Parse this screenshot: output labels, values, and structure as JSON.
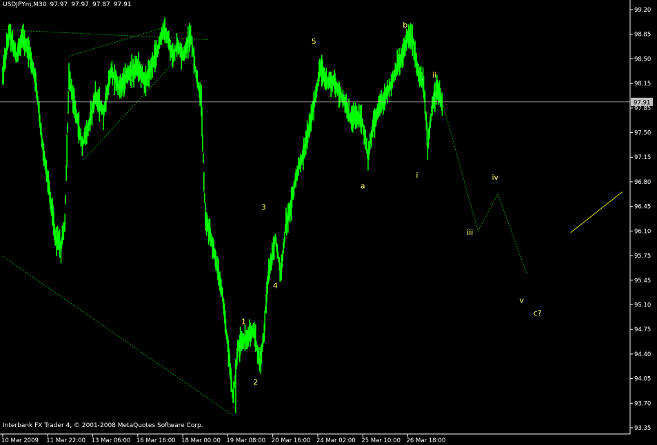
{
  "header": {
    "symbol": "USDJPYm,M30",
    "ohlc": [
      "97.97",
      "97.97",
      "97.87",
      "97.91"
    ]
  },
  "footer": {
    "copyright": "Interbank FX Trader 4, © 2001-2008 MetaQuotes Software Corp."
  },
  "colors": {
    "background": "#000000",
    "candles": "#00ff00",
    "trendlines": "#00a000",
    "wave_labels": "#ffff66",
    "price_line": "#c0c0c0",
    "axis": "#ffffff"
  },
  "chart_data": {
    "type": "line",
    "symbol": "USDJPYm",
    "timeframe": "M30",
    "ylim": [
      93.35,
      99.2
    ],
    "grid": false,
    "current_price": "97.91",
    "y_ticks": [
      "99.20",
      "98.85",
      "98.50",
      "98.15",
      "97.85",
      "97.50",
      "97.15",
      "96.80",
      "96.45",
      "96.10",
      "95.75",
      "95.45",
      "95.10",
      "94.75",
      "94.40",
      "94.05",
      "93.70",
      "93.35"
    ],
    "x_ticks": [
      "10 Mar 2009",
      "11 Mar 22:00",
      "13 Mar 06:00",
      "16 Mar 16:00",
      "18 Mar 00:00",
      "19 Mar 08:00",
      "20 Mar 16:00",
      "24 Mar 02:00",
      "25 Mar 10:00",
      "26 Mar 18:00"
    ],
    "x_tick_bar_index": [
      0,
      34,
      68,
      102,
      136,
      170,
      204,
      238,
      272,
      306
    ],
    "series": [
      {
        "name": "",
        "price_path": [
          [
            0,
            98.3
          ],
          [
            5,
            98.9
          ],
          [
            10,
            98.55
          ],
          [
            15,
            98.8
          ],
          [
            20,
            98.6
          ],
          [
            25,
            98.2
          ],
          [
            30,
            97.3
          ],
          [
            35,
            96.7
          ],
          [
            40,
            96.0
          ],
          [
            44,
            95.9
          ],
          [
            47,
            96.2
          ],
          [
            50,
            98.25
          ],
          [
            55,
            97.8
          ],
          [
            60,
            97.3
          ],
          [
            64,
            97.5
          ],
          [
            70,
            98.0
          ],
          [
            76,
            97.75
          ],
          [
            82,
            98.35
          ],
          [
            88,
            98.1
          ],
          [
            95,
            98.3
          ],
          [
            102,
            98.4
          ],
          [
            108,
            98.2
          ],
          [
            114,
            98.5
          ],
          [
            118,
            98.7
          ],
          [
            122,
            98.95
          ],
          [
            128,
            98.55
          ],
          [
            132,
            98.7
          ],
          [
            136,
            98.55
          ],
          [
            142,
            98.85
          ],
          [
            146,
            98.3
          ],
          [
            150,
            97.9
          ],
          [
            153,
            96.3
          ],
          [
            160,
            95.8
          ],
          [
            166,
            95.2
          ],
          [
            170,
            94.5
          ],
          [
            174,
            93.75
          ],
          [
            178,
            94.5
          ],
          [
            184,
            94.6
          ],
          [
            190,
            94.7
          ],
          [
            194,
            94.25
          ],
          [
            197,
            94.6
          ],
          [
            200,
            95.4
          ],
          [
            206,
            96.0
          ],
          [
            210,
            95.5
          ],
          [
            214,
            96.2
          ],
          [
            218,
            96.5
          ],
          [
            222,
            96.9
          ],
          [
            226,
            97.1
          ],
          [
            232,
            97.6
          ],
          [
            236,
            97.95
          ],
          [
            240,
            98.4
          ],
          [
            244,
            98.2
          ],
          [
            250,
            98.2
          ],
          [
            256,
            98.0
          ],
          [
            262,
            97.7
          ],
          [
            268,
            97.7
          ],
          [
            272,
            97.6
          ],
          [
            276,
            97.15
          ],
          [
            280,
            97.6
          ],
          [
            286,
            97.9
          ],
          [
            292,
            98.1
          ],
          [
            298,
            98.4
          ],
          [
            302,
            98.55
          ],
          [
            306,
            98.85
          ],
          [
            310,
            98.75
          ],
          [
            314,
            98.3
          ],
          [
            318,
            98.15
          ],
          [
            321,
            97.3
          ],
          [
            324,
            97.8
          ],
          [
            328,
            98.1
          ],
          [
            332,
            97.9
          ]
        ],
        "wick_bottoms": [
          {
            "bar": 44,
            "price": 95.65
          },
          {
            "bar": 176,
            "price": 93.55
          },
          {
            "bar": 195,
            "price": 94.1
          },
          {
            "bar": 276,
            "price": 96.95
          },
          {
            "bar": 321,
            "price": 97.1
          }
        ],
        "wick_tops": [
          {
            "bar": 122,
            "price": 98.95
          },
          {
            "bar": 306,
            "price": 98.88
          }
        ]
      }
    ],
    "trendlines": [
      {
        "from": [
          0,
          98.92
        ],
        "to": [
          122,
          98.95
        ],
        "to_end": [
          156,
          98.78
        ]
      },
      {
        "from": [
          50,
          98.55
        ],
        "to": [
          122,
          98.95
        ]
      },
      {
        "from": [
          61,
          97.1
        ],
        "to": [
          146,
          98.8
        ]
      },
      {
        "from": [
          0,
          95.75
        ],
        "to": [
          174,
          93.52
        ]
      }
    ],
    "projection": [
      {
        "from": [
          333,
          97.85
        ],
        "to": [
          359,
          96.1
        ]
      },
      {
        "from": [
          359,
          96.1
        ],
        "to": [
          374,
          96.62
        ]
      },
      {
        "from": [
          374,
          96.62
        ],
        "to": [
          396,
          95.5
        ]
      }
    ],
    "yellow_line": {
      "from": [
        429,
        96.08
      ],
      "to": [
        468,
        96.65
      ]
    },
    "wave_labels": [
      {
        "text": "1",
        "bar": 182,
        "price": 94.8
      },
      {
        "text": "2",
        "bar": 191,
        "price": 93.95
      },
      {
        "text": "3",
        "bar": 197,
        "price": 96.4
      },
      {
        "text": "4",
        "bar": 206,
        "price": 95.3
      },
      {
        "text": "5",
        "bar": 235,
        "price": 98.72
      },
      {
        "text": "a",
        "bar": 272,
        "price": 96.7
      },
      {
        "text": "b",
        "bar": 304,
        "price": 98.95
      },
      {
        "text": "ii",
        "bar": 326,
        "price": 98.25
      },
      {
        "text": "i",
        "bar": 313,
        "price": 96.85
      },
      {
        "text": "iii",
        "bar": 353,
        "price": 96.05
      },
      {
        "text": "iv",
        "bar": 372,
        "price": 96.82
      },
      {
        "text": "v",
        "bar": 392,
        "price": 95.1
      },
      {
        "text": "c?",
        "bar": 404,
        "price": 94.92
      }
    ]
  }
}
